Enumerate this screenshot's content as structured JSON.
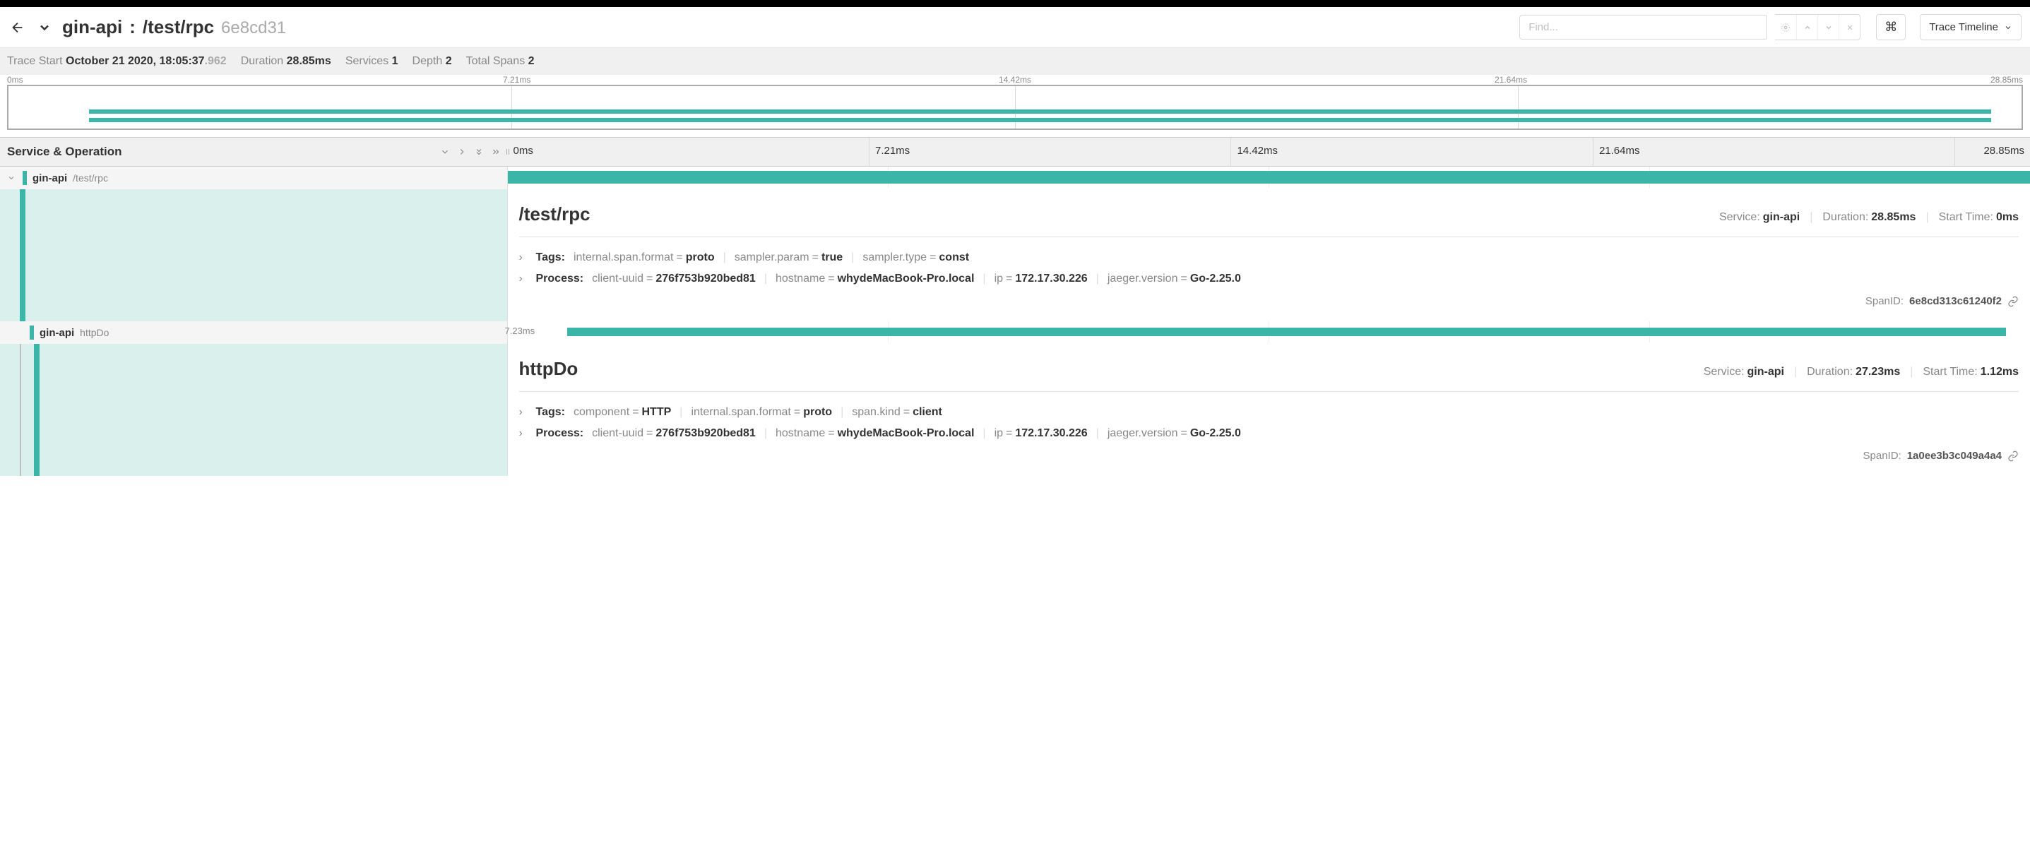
{
  "header": {
    "service": "gin-api",
    "operation": "/test/rpc",
    "trace_id": "6e8cd31",
    "find_placeholder": "Find...",
    "view_label": "Trace Timeline"
  },
  "summary": {
    "trace_start_label": "Trace Start",
    "trace_start": "October 21 2020, 18:05:37",
    "trace_start_ms": ".962",
    "duration_label": "Duration",
    "duration": "28.85ms",
    "services_label": "Services",
    "services": "1",
    "depth_label": "Depth",
    "depth": "2",
    "spans_label": "Total Spans",
    "spans": "2"
  },
  "ticks": [
    "0ms",
    "7.21ms",
    "14.42ms",
    "21.64ms",
    "28.85ms"
  ],
  "left_header": "Service & Operation",
  "spans": [
    {
      "service": "gin-api",
      "operation": "/test/rpc",
      "bar_left": "0%",
      "bar_width": "100%",
      "detail": {
        "title": "/test/rpc",
        "service_label": "Service:",
        "service": "gin-api",
        "duration_label": "Duration:",
        "duration": "28.85ms",
        "start_label": "Start Time:",
        "start": "0ms",
        "tags_label": "Tags:",
        "tags": [
          {
            "k": "internal.span.format",
            "v": "proto"
          },
          {
            "k": "sampler.param",
            "v": "true"
          },
          {
            "k": "sampler.type",
            "v": "const"
          }
        ],
        "process_label": "Process:",
        "process": [
          {
            "k": "client-uuid",
            "v": "276f753b920bed81"
          },
          {
            "k": "hostname",
            "v": "whydeMacBook-Pro.local"
          },
          {
            "k": "ip",
            "v": "172.17.30.226"
          },
          {
            "k": "jaeger.version",
            "v": "Go-2.25.0"
          }
        ],
        "spanid_label": "SpanID:",
        "spanid": "6e8cd313c61240f2"
      }
    },
    {
      "service": "gin-api",
      "operation": "httpDo",
      "dur_label": "7.23ms",
      "bar_left": "3.9%",
      "bar_width": "94.5%",
      "detail": {
        "title": "httpDo",
        "service_label": "Service:",
        "service": "gin-api",
        "duration_label": "Duration:",
        "duration": "27.23ms",
        "start_label": "Start Time:",
        "start": "1.12ms",
        "tags_label": "Tags:",
        "tags": [
          {
            "k": "component",
            "v": "HTTP"
          },
          {
            "k": "internal.span.format",
            "v": "proto"
          },
          {
            "k": "span.kind",
            "v": "client"
          }
        ],
        "process_label": "Process:",
        "process": [
          {
            "k": "client-uuid",
            "v": "276f753b920bed81"
          },
          {
            "k": "hostname",
            "v": "whydeMacBook-Pro.local"
          },
          {
            "k": "ip",
            "v": "172.17.30.226"
          },
          {
            "k": "jaeger.version",
            "v": "Go-2.25.0"
          }
        ],
        "spanid_label": "SpanID:",
        "spanid": "1a0ee3b3c049a4a4"
      }
    }
  ]
}
